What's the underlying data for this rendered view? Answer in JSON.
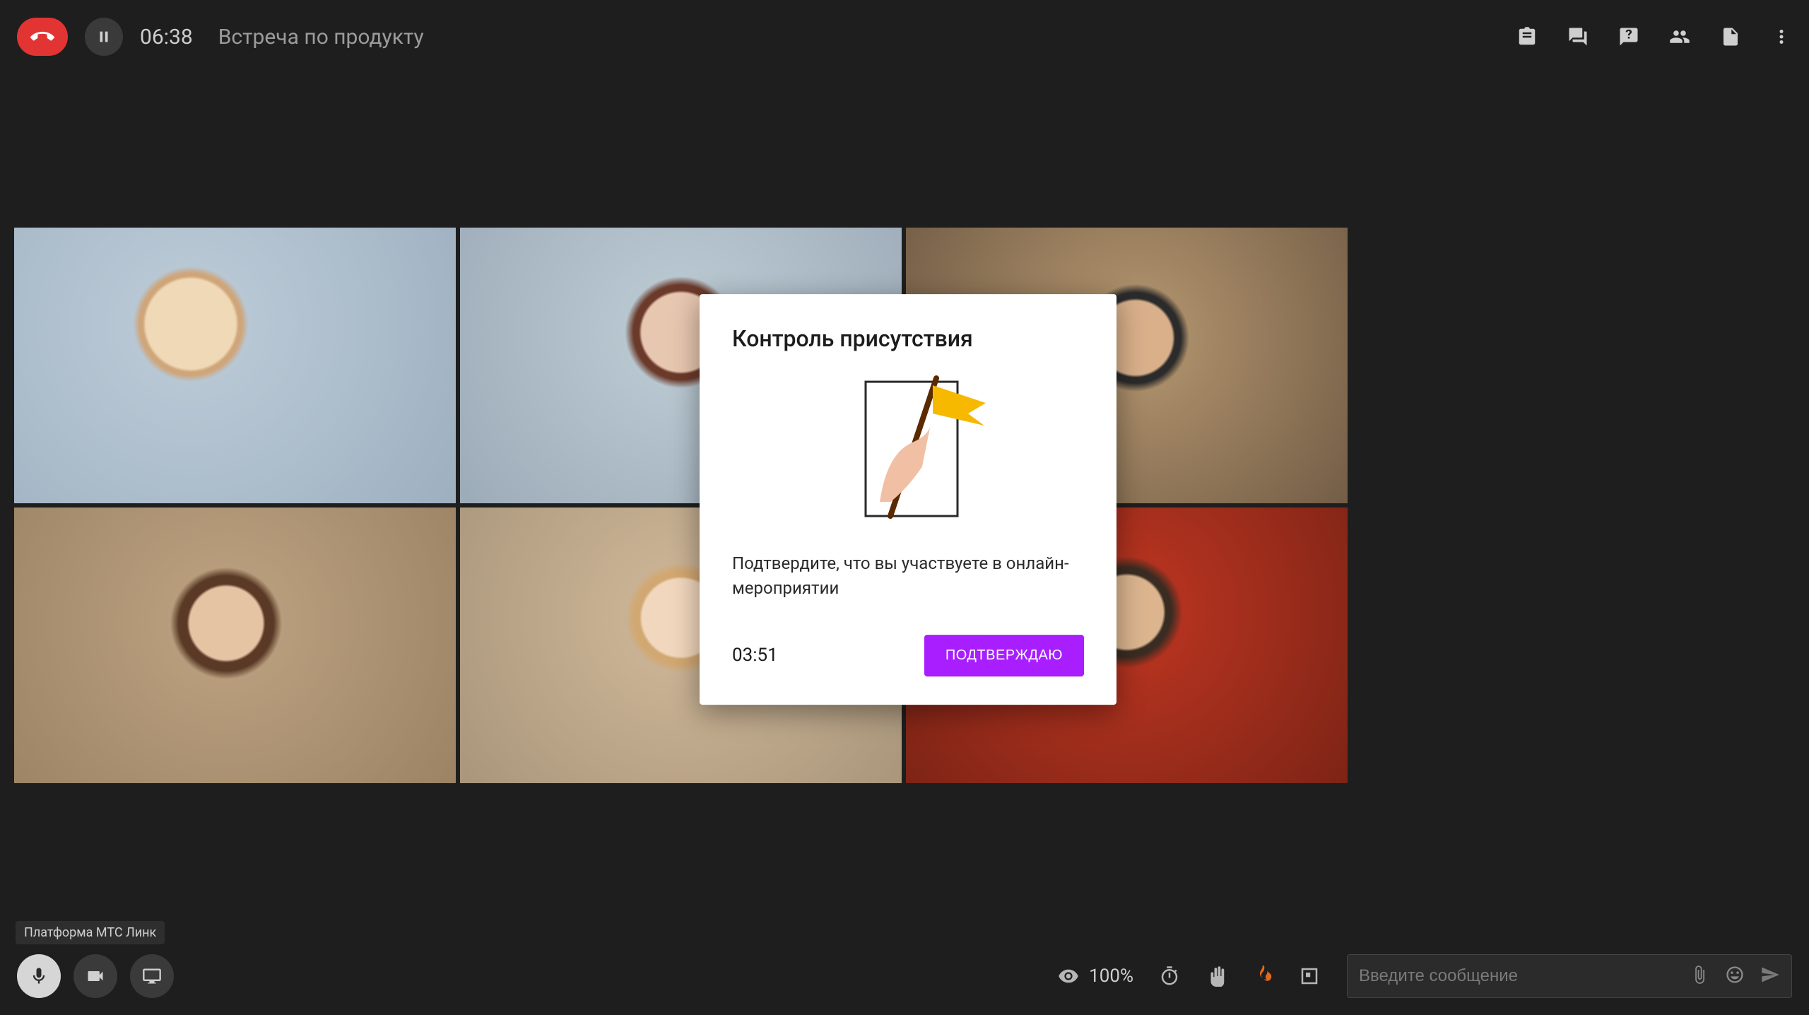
{
  "topbar": {
    "timer": "06:38",
    "title": "Встреча по продукту"
  },
  "modal": {
    "title": "Контроль присутствия",
    "body": "Подтвердите, что вы участвуете в онлайн-мероприятии",
    "countdown": "03:51",
    "confirm_label": "ПОДТВЕРЖДАЮ"
  },
  "tooltip": {
    "text": "Платформа МТС Линк"
  },
  "bottombar": {
    "view_percent": "100%",
    "chat_placeholder": "Введите сообщение"
  }
}
